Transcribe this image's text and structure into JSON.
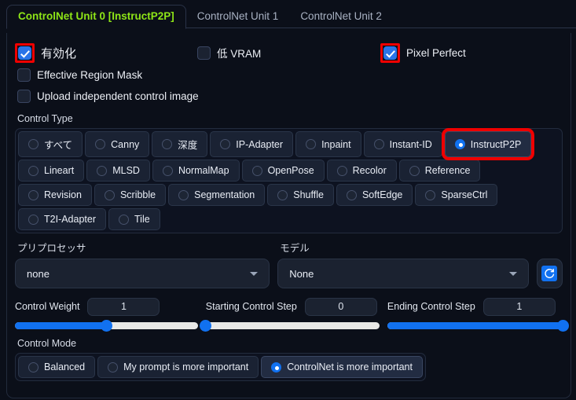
{
  "tabs": [
    {
      "label": "ControlNet Unit 0 [InstructP2P]",
      "active": true
    },
    {
      "label": "ControlNet Unit 1",
      "active": false
    },
    {
      "label": "ControlNet Unit 2",
      "active": false
    }
  ],
  "colors": {
    "active_tab_text": "#8ee517",
    "accent_blue": "#1171f0",
    "highlight_red": "#ef0000",
    "panel_bg": "#0b0f19",
    "slider_track": "#e8e8e6"
  },
  "checkboxes": {
    "enable": {
      "label": "有効化",
      "checked": true,
      "highlighted": true
    },
    "low_vram": {
      "label": "低 VRAM",
      "checked": false,
      "highlighted": false
    },
    "pixel_perfect": {
      "label": "Pixel Perfect",
      "checked": true,
      "highlighted": true
    },
    "effective_region_mask": {
      "label": "Effective Region Mask",
      "checked": false,
      "highlighted": false
    },
    "upload_independent": {
      "label": "Upload independent control image",
      "checked": false,
      "highlighted": false
    }
  },
  "control_type": {
    "label": "Control Type",
    "rows": [
      [
        {
          "label": "すべて",
          "selected": false,
          "highlighted": false
        },
        {
          "label": "Canny",
          "selected": false,
          "highlighted": false
        },
        {
          "label": "深度",
          "selected": false,
          "highlighted": false
        },
        {
          "label": "IP-Adapter",
          "selected": false,
          "highlighted": false
        },
        {
          "label": "Inpaint",
          "selected": false,
          "highlighted": false
        },
        {
          "label": "Instant-ID",
          "selected": false,
          "highlighted": false
        },
        {
          "label": "InstructP2P",
          "selected": true,
          "highlighted": true
        }
      ],
      [
        {
          "label": "Lineart",
          "selected": false,
          "highlighted": false
        },
        {
          "label": "MLSD",
          "selected": false,
          "highlighted": false
        },
        {
          "label": "NormalMap",
          "selected": false,
          "highlighted": false
        },
        {
          "label": "OpenPose",
          "selected": false,
          "highlighted": false
        },
        {
          "label": "Recolor",
          "selected": false,
          "highlighted": false
        },
        {
          "label": "Reference",
          "selected": false,
          "highlighted": false
        }
      ],
      [
        {
          "label": "Revision",
          "selected": false,
          "highlighted": false
        },
        {
          "label": "Scribble",
          "selected": false,
          "highlighted": false
        },
        {
          "label": "Segmentation",
          "selected": false,
          "highlighted": false
        },
        {
          "label": "Shuffle",
          "selected": false,
          "highlighted": false
        },
        {
          "label": "SoftEdge",
          "selected": false,
          "highlighted": false
        },
        {
          "label": "SparseCtrl",
          "selected": false,
          "highlighted": false
        }
      ],
      [
        {
          "label": "T2I-Adapter",
          "selected": false,
          "highlighted": false
        },
        {
          "label": "Tile",
          "selected": false,
          "highlighted": false
        }
      ]
    ]
  },
  "dropdowns": {
    "preprocessor": {
      "label": "プリプロセッサ",
      "value": "none"
    },
    "model": {
      "label": "モデル",
      "value": "None"
    },
    "refresh_icon": "refresh-icon"
  },
  "sliders": [
    {
      "name": "Control Weight",
      "value": "1",
      "fill_percent": 50
    },
    {
      "name": "Starting Control Step",
      "value": "0",
      "fill_percent": 0
    },
    {
      "name": "Ending Control Step",
      "value": "1",
      "fill_percent": 100
    }
  ],
  "control_mode": {
    "label": "Control Mode",
    "options": [
      {
        "label": "Balanced",
        "selected": false
      },
      {
        "label": "My prompt is more important",
        "selected": false
      },
      {
        "label": "ControlNet is more important",
        "selected": true
      }
    ]
  }
}
